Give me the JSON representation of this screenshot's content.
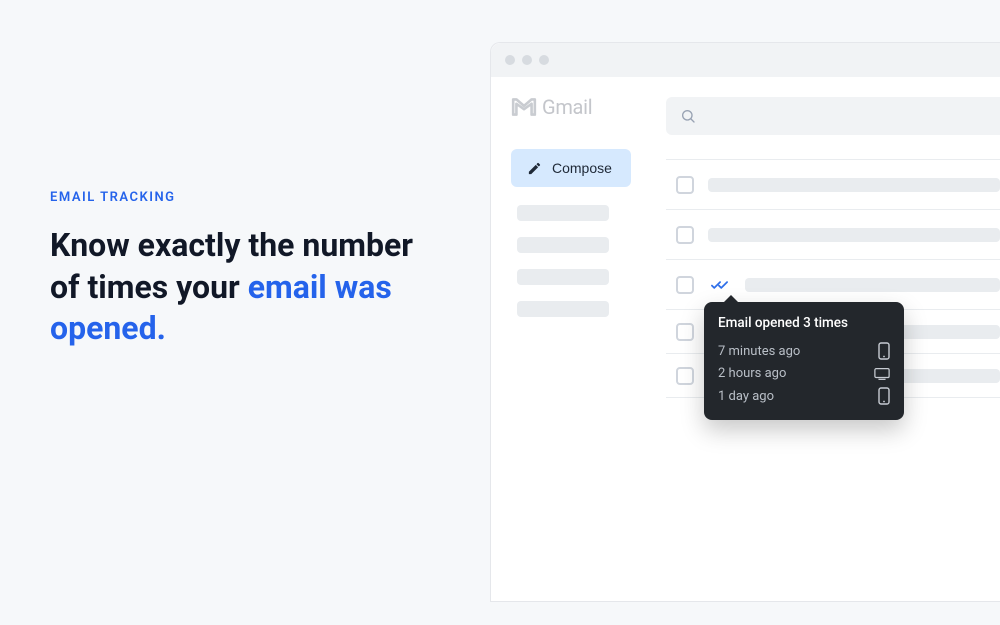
{
  "marketing": {
    "eyebrow": "EMAIL TRACKING",
    "headline_plain": "Know exactly the number of times your ",
    "headline_highlight": "email was opened."
  },
  "app": {
    "brand": "Gmail",
    "compose_label": "Compose"
  },
  "tooltip": {
    "title": "Email opened 3 times",
    "rows": [
      {
        "time": "7 minutes ago",
        "device": "mobile"
      },
      {
        "time": "2 hours ago",
        "device": "desktop"
      },
      {
        "time": "1 day ago",
        "device": "mobile"
      }
    ]
  }
}
